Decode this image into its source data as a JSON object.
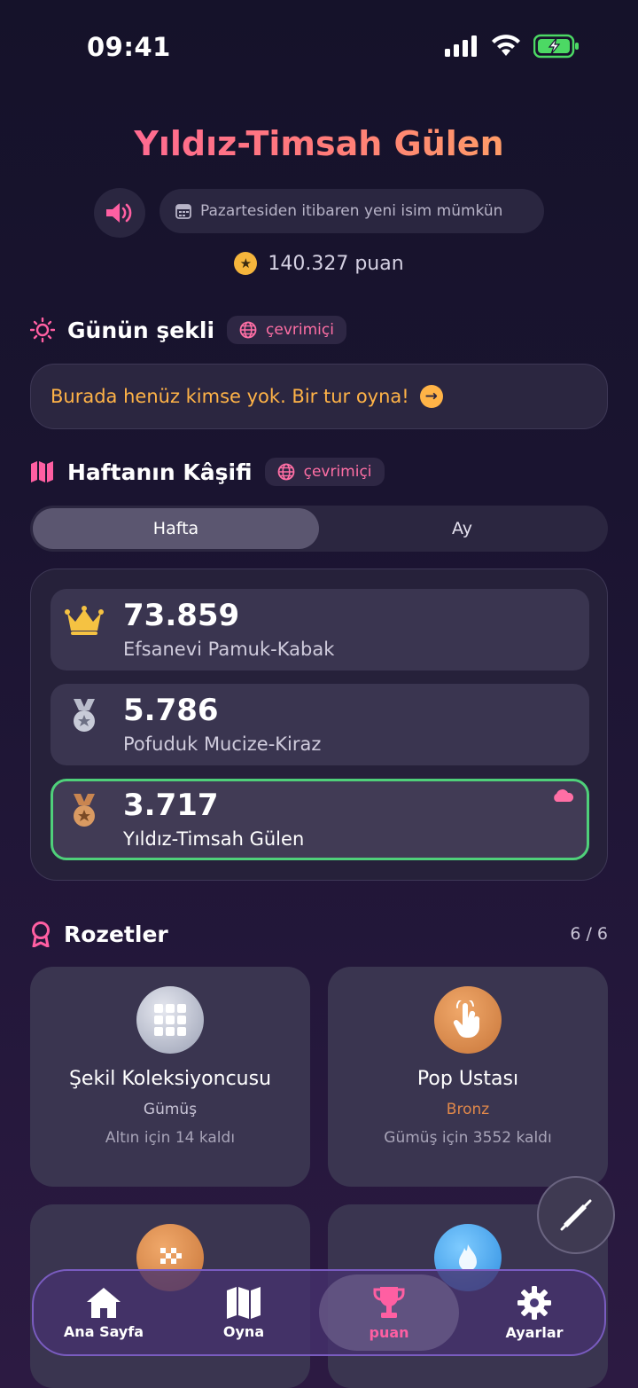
{
  "status_bar": {
    "time": "09:41"
  },
  "header": {
    "player_name": "Yıldız-Timsah Gülen",
    "rename_note": "Pazartesiden itibaren yeni isim mümkün",
    "points": "140.327 puan"
  },
  "daily_shape": {
    "title": "Günün şekli",
    "online_label": "çevrimiçi",
    "empty_message": "Burada henüz kimse yok. Bir tur oyna!"
  },
  "explorer": {
    "title": "Haftanın Kâşifi",
    "online_label": "çevrimiçi",
    "tabs": [
      "Hafta",
      "Ay"
    ],
    "active_tab": "Hafta",
    "leaderboard": [
      {
        "rank_icon": "crown-icon",
        "score": "73.859",
        "name": "Efsanevi Pamuk-Kabak"
      },
      {
        "rank_icon": "silver-medal-icon",
        "score": "5.786",
        "name": "Pofuduk Mucize-Kiraz"
      },
      {
        "rank_icon": "bronze-medal-icon",
        "score": "3.717",
        "name": "Yıldız-Timsah Gülen",
        "is_me": true
      }
    ]
  },
  "badges": {
    "title": "Rozetler",
    "count": "6 / 6",
    "items": [
      {
        "icon": "grid-icon",
        "title": "Şekil Koleksiyoncusu",
        "tier": "Gümüş",
        "next": "Altın için 14 kaldı"
      },
      {
        "icon": "tap-hand-icon",
        "title": "Pop Ustası",
        "tier": "Bronz",
        "next": "Gümüş için 3552 kaldı"
      }
    ]
  },
  "nav": {
    "items": [
      {
        "label": "Ana Sayfa",
        "icon": "home-icon"
      },
      {
        "label": "Oyna",
        "icon": "map-icon"
      },
      {
        "label": "puan",
        "icon": "trophy-icon"
      },
      {
        "label": "Ayarlar",
        "icon": "gear-icon"
      }
    ],
    "active": "puan"
  },
  "colors": {
    "accent_pink": "#ff5fa2",
    "accent_orange": "#ffb347",
    "highlight_green": "#4fd07a",
    "gold": "#f5c242",
    "bronze": "#e0884a"
  }
}
